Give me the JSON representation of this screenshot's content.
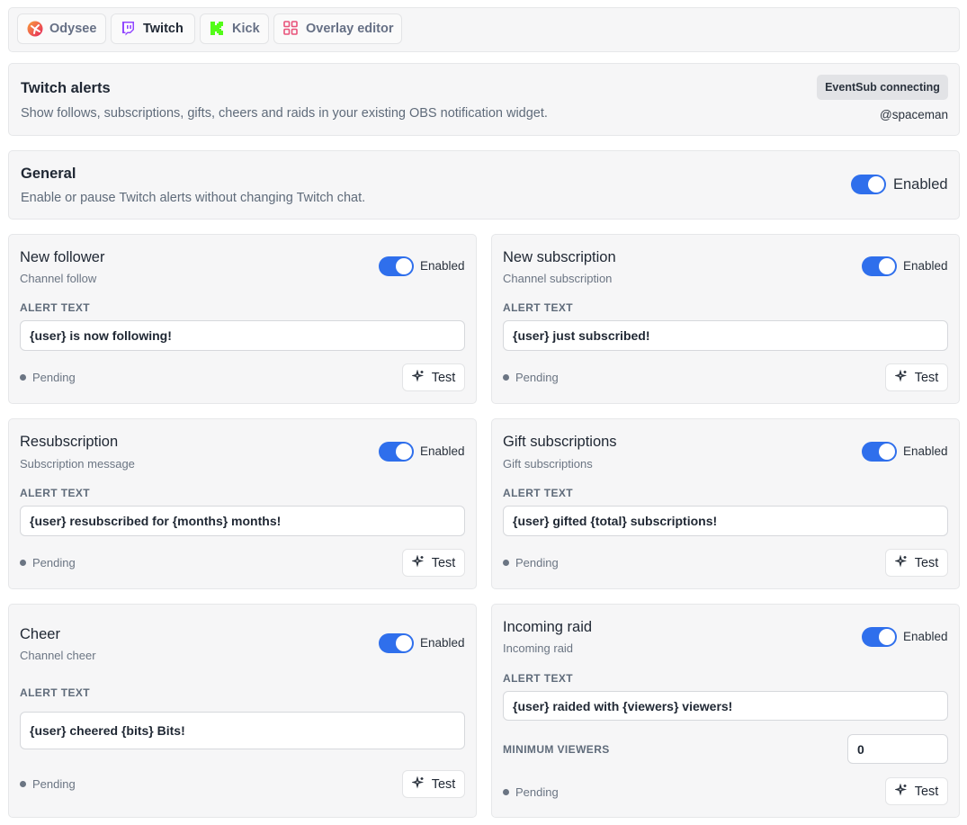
{
  "nav": {
    "tabs": [
      {
        "label": "Odysee",
        "icon": "odysee-icon"
      },
      {
        "label": "Twitch",
        "icon": "twitch-icon"
      },
      {
        "label": "Kick",
        "icon": "kick-icon"
      },
      {
        "label": "Overlay editor",
        "icon": "grid-icon"
      }
    ],
    "active": "Twitch"
  },
  "header": {
    "title": "Twitch alerts",
    "description": "Show follows, subscriptions, gifts, cheers and raids in your existing OBS notification widget.",
    "badge": "EventSub connecting",
    "username": "@spaceman"
  },
  "general": {
    "title": "General",
    "description": "Enable or pause Twitch alerts without changing Twitch chat.",
    "toggle_label": "Enabled"
  },
  "cards": [
    {
      "title": "New follower",
      "subtitle": "Channel follow",
      "toggle_label": "Enabled",
      "field_label": "ALERT TEXT",
      "alert_text": "{user} is now following!",
      "status": "Pending",
      "test_label": "Test"
    },
    {
      "title": "New subscription",
      "subtitle": "Channel subscription",
      "toggle_label": "Enabled",
      "field_label": "ALERT TEXT",
      "alert_text": "{user} just subscribed!",
      "status": "Pending",
      "test_label": "Test"
    },
    {
      "title": "Resubscription",
      "subtitle": "Subscription message",
      "toggle_label": "Enabled",
      "field_label": "ALERT TEXT",
      "alert_text": "{user} resubscribed for {months} months!",
      "status": "Pending",
      "test_label": "Test"
    },
    {
      "title": "Gift subscriptions",
      "subtitle": "Gift subscriptions",
      "toggle_label": "Enabled",
      "field_label": "ALERT TEXT",
      "alert_text": "{user} gifted {total} subscriptions!",
      "status": "Pending",
      "test_label": "Test"
    },
    {
      "title": "Cheer",
      "subtitle": "Channel cheer",
      "toggle_label": "Enabled",
      "field_label": "ALERT TEXT",
      "alert_text": "{user} cheered {bits} Bits!",
      "status": "Pending",
      "test_label": "Test"
    },
    {
      "title": "Incoming raid",
      "subtitle": "Incoming raid",
      "toggle_label": "Enabled",
      "field_label": "ALERT TEXT",
      "alert_text": "{user} raided with {viewers} viewers!",
      "min_label": "MINIMUM VIEWERS",
      "min_value": "0",
      "status": "Pending",
      "test_label": "Test"
    }
  ],
  "colors": {
    "accent": "#2f6fec",
    "panel": "#f6f6f7",
    "twitch": "#9146ff",
    "kick": "#53fc18",
    "overlay": "#e8537a"
  }
}
